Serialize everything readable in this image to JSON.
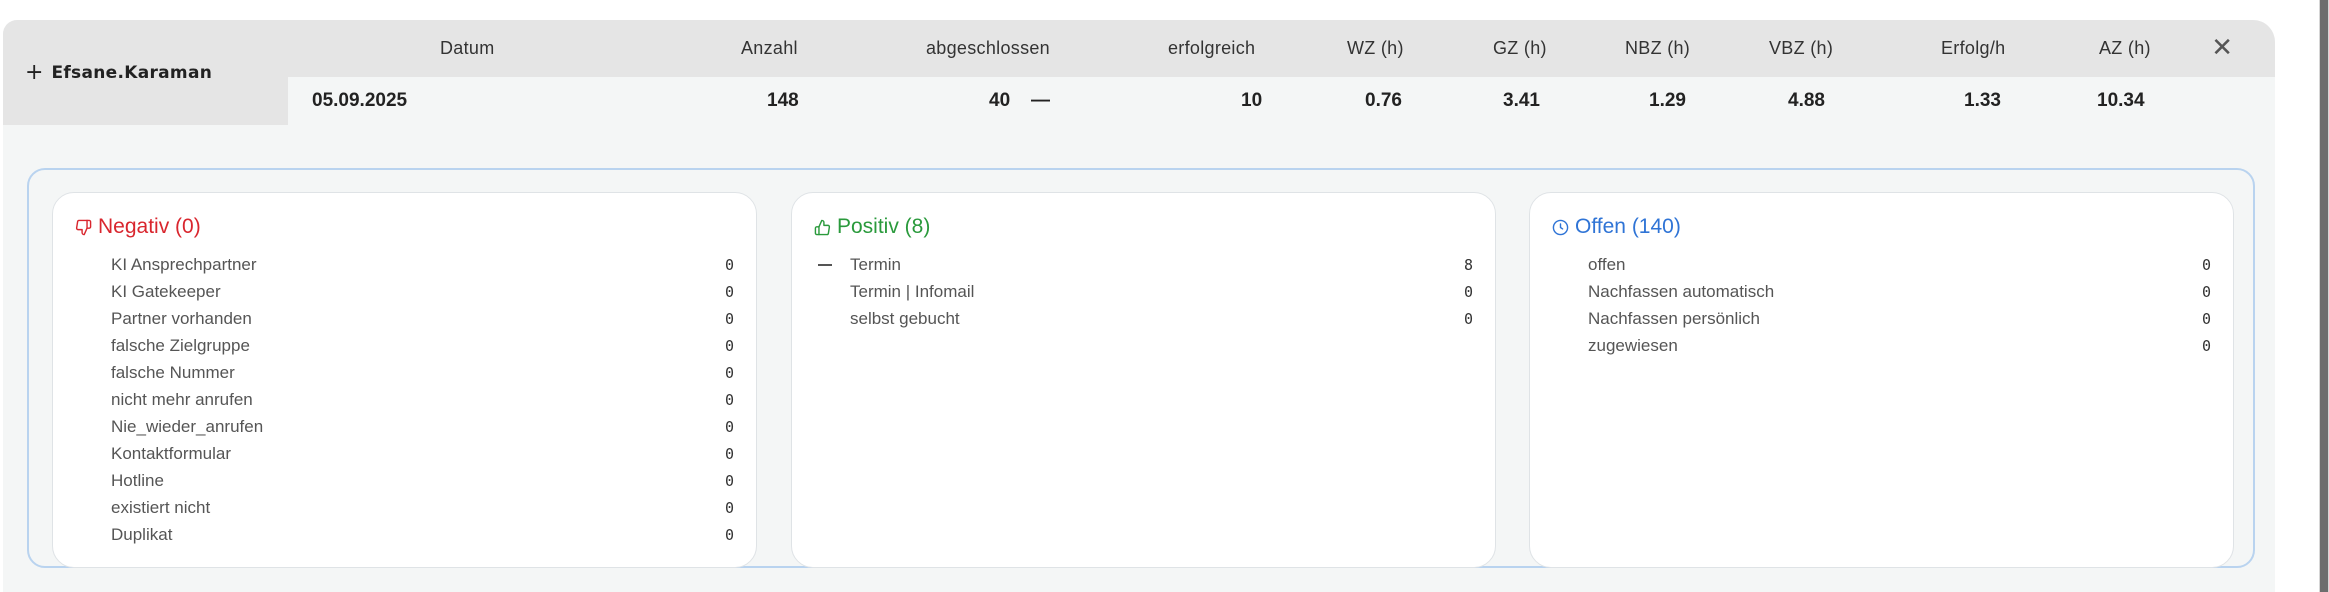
{
  "user": {
    "expand_icon": "plus-icon",
    "name": "Efsane.Karaman"
  },
  "headers": [
    "Datum",
    "Anzahl",
    "abgeschlossen",
    "erfolgreich",
    "WZ (h)",
    "GZ (h)",
    "NBZ (h)",
    "VBZ (h)",
    "Erfolg/h",
    "AZ (h)"
  ],
  "row": {
    "datum": "05.09.2025",
    "anzahl": "148",
    "abgeschlossen": "40",
    "erfolgreich": "10",
    "wz": "0.76",
    "gz": "3.41",
    "nbz": "1.29",
    "vbz": "4.88",
    "erfolg_h": "1.33",
    "az": "10.34"
  },
  "close_icon": "close-icon",
  "panels": {
    "negativ": {
      "title": "Negativ (0)",
      "icon": "thumbs-down-icon",
      "color": "#d9262e",
      "items": [
        {
          "label": "KI Ansprechpartner",
          "value": "0"
        },
        {
          "label": "KI Gatekeeper",
          "value": "0"
        },
        {
          "label": "Partner vorhanden",
          "value": "0"
        },
        {
          "label": "falsche Zielgruppe",
          "value": "0"
        },
        {
          "label": "falsche Nummer",
          "value": "0"
        },
        {
          "label": "nicht mehr anrufen",
          "value": "0"
        },
        {
          "label": "Nie_wieder_anrufen",
          "value": "0"
        },
        {
          "label": "Kontaktformular",
          "value": "0"
        },
        {
          "label": "Hotline",
          "value": "0"
        },
        {
          "label": "existiert nicht",
          "value": "0"
        },
        {
          "label": "Duplikat",
          "value": "0"
        }
      ]
    },
    "positiv": {
      "title": "Positiv (8)",
      "icon": "thumbs-up-icon",
      "color": "#2a9a3c",
      "items": [
        {
          "label": "Termin",
          "value": "8"
        },
        {
          "label": "Termin | Infomail",
          "value": "0"
        },
        {
          "label": "selbst gebucht",
          "value": "0"
        }
      ]
    },
    "offen": {
      "title": "Offen (140)",
      "icon": "clock-icon",
      "color": "#2f74d6",
      "items": [
        {
          "label": "offen",
          "value": "0"
        },
        {
          "label": "Nachfassen automatisch",
          "value": "0"
        },
        {
          "label": "Nachfassen persönlich",
          "value": "0"
        },
        {
          "label": "zugewiesen",
          "value": "0"
        }
      ]
    }
  }
}
